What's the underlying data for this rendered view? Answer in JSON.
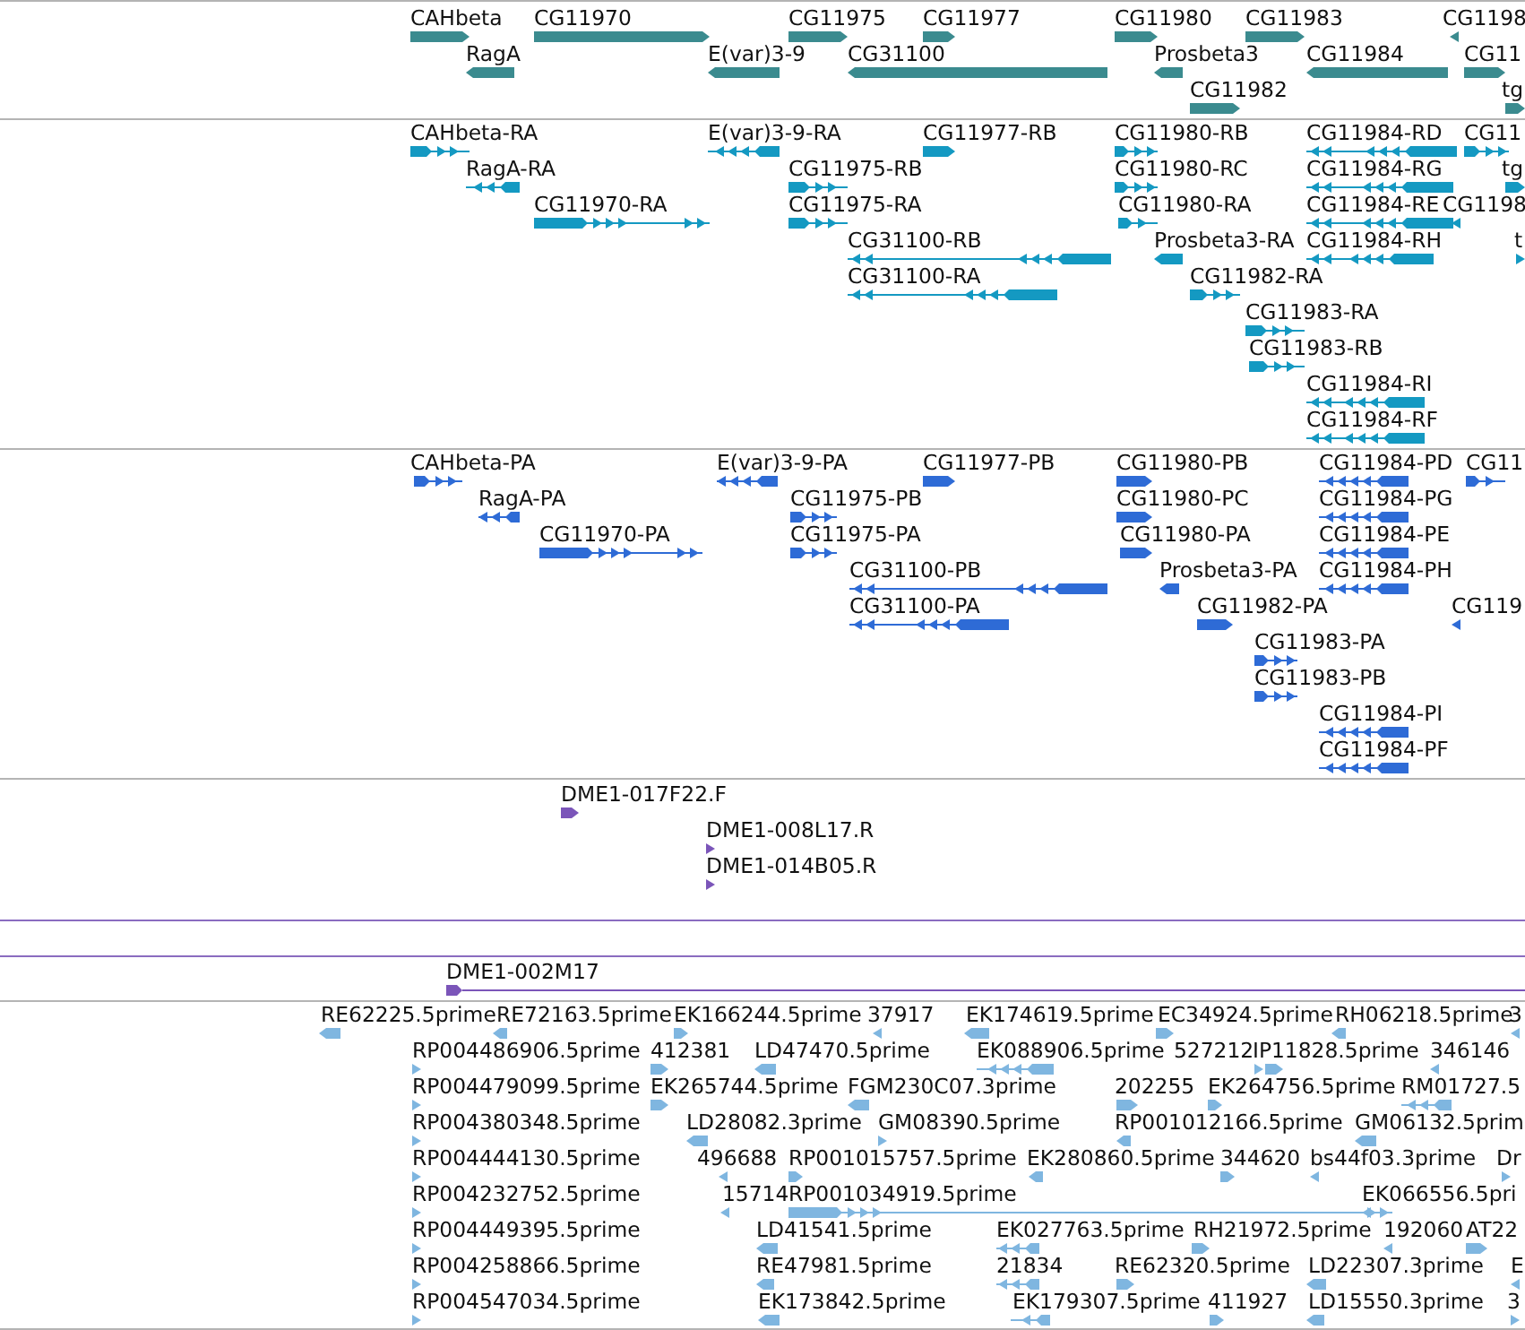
{
  "tracks": [
    {
      "kind": "gene",
      "features": [
        {
          "label": "CAHbeta",
          "forward": true
        },
        {
          "label": "CG11970",
          "forward": true
        },
        {
          "label": "CG11975",
          "forward": true
        },
        {
          "label": "CG11977",
          "forward": true
        },
        {
          "label": "CG11980",
          "forward": true
        },
        {
          "label": "CG11983",
          "forward": true
        },
        {
          "label": "CG1198",
          "forward": false
        },
        {
          "label": "RagA",
          "forward": false
        },
        {
          "label": "E(var)3-9",
          "forward": false
        },
        {
          "label": "CG31100",
          "forward": false
        },
        {
          "label": "Prosbeta3",
          "forward": false
        },
        {
          "label": "CG11984",
          "forward": false
        },
        {
          "label": "CG11",
          "forward": true
        },
        {
          "label": "CG11982",
          "forward": true
        },
        {
          "label": "tg",
          "forward": true
        }
      ]
    },
    {
      "kind": "transcript",
      "features": [
        {
          "label": "CAHbeta-RA",
          "forward": true
        },
        {
          "label": "E(var)3-9-RA",
          "forward": false
        },
        {
          "label": "CG11977-RB",
          "forward": true
        },
        {
          "label": "CG11980-RB",
          "forward": true
        },
        {
          "label": "CG11984-RD",
          "forward": false
        },
        {
          "label": "CG11",
          "forward": true
        },
        {
          "label": "RagA-RA",
          "forward": false
        },
        {
          "label": "CG11975-RB",
          "forward": true
        },
        {
          "label": "CG11980-RC",
          "forward": true
        },
        {
          "label": "CG11984-RG",
          "forward": false
        },
        {
          "label": "tg",
          "forward": true
        },
        {
          "label": "CG11970-RA",
          "forward": true
        },
        {
          "label": "CG11975-RA",
          "forward": true
        },
        {
          "label": "CG11980-RA",
          "forward": true
        },
        {
          "label": "CG11984-RE",
          "forward": false
        },
        {
          "label": "CG1198",
          "forward": false
        },
        {
          "label": "CG31100-RB",
          "forward": false
        },
        {
          "label": "Prosbeta3-RA",
          "forward": false
        },
        {
          "label": "CG11984-RH",
          "forward": false
        },
        {
          "label": "t",
          "forward": true
        },
        {
          "label": "CG31100-RA",
          "forward": false
        },
        {
          "label": "CG11982-RA",
          "forward": true
        },
        {
          "label": "CG11983-RA",
          "forward": true
        },
        {
          "label": "CG11983-RB",
          "forward": true
        },
        {
          "label": "CG11984-RI",
          "forward": false
        },
        {
          "label": "CG11984-RF",
          "forward": false
        }
      ]
    },
    {
      "kind": "protein",
      "features": [
        {
          "label": "CAHbeta-PA",
          "forward": true
        },
        {
          "label": "E(var)3-9-PA",
          "forward": false
        },
        {
          "label": "CG11977-PB",
          "forward": true
        },
        {
          "label": "CG11980-PB",
          "forward": true
        },
        {
          "label": "CG11984-PD",
          "forward": false
        },
        {
          "label": "CG11",
          "forward": true
        },
        {
          "label": "RagA-PA",
          "forward": false
        },
        {
          "label": "CG11975-PB",
          "forward": true
        },
        {
          "label": "CG11980-PC",
          "forward": true
        },
        {
          "label": "CG11984-PG",
          "forward": false
        },
        {
          "label": "CG11970-PA",
          "forward": true
        },
        {
          "label": "CG11975-PA",
          "forward": true
        },
        {
          "label": "CG11980-PA",
          "forward": true
        },
        {
          "label": "CG11984-PE",
          "forward": false
        },
        {
          "label": "CG31100-PB",
          "forward": false
        },
        {
          "label": "Prosbeta3-PA",
          "forward": false
        },
        {
          "label": "CG11984-PH",
          "forward": false
        },
        {
          "label": "CG31100-PA",
          "forward": false
        },
        {
          "label": "CG11982-PA",
          "forward": true
        },
        {
          "label": "CG119",
          "forward": false
        },
        {
          "label": "CG11983-PA",
          "forward": true
        },
        {
          "label": "CG11983-PB",
          "forward": true
        },
        {
          "label": "CG11984-PI",
          "forward": false
        },
        {
          "label": "CG11984-PF",
          "forward": false
        }
      ]
    },
    {
      "kind": "clone-end",
      "features": [
        {
          "label": "DME1-017F22.F",
          "forward": true
        },
        {
          "label": "DME1-008L17.R",
          "forward": true
        },
        {
          "label": "DME1-014B05.R",
          "forward": true
        }
      ]
    },
    {
      "kind": "clone",
      "features": [
        {
          "label": "DME1-002M17",
          "forward": true
        }
      ]
    },
    {
      "kind": "est",
      "features": [
        {
          "label": "RE62225.5prime",
          "forward": false
        },
        {
          "label": "RE72163.5prime",
          "forward": false
        },
        {
          "label": "EK166244.5prime",
          "forward": true
        },
        {
          "label": "37917",
          "forward": false
        },
        {
          "label": "EK174619.5prime",
          "forward": false
        },
        {
          "label": "EC34924.5prime",
          "forward": true
        },
        {
          "label": "RH06218.5prime",
          "forward": false
        },
        {
          "label": "3",
          "forward": false
        },
        {
          "label": "RP004486906.5prime",
          "forward": true
        },
        {
          "label": "412381",
          "forward": true
        },
        {
          "label": "LD47470.5prime",
          "forward": false
        },
        {
          "label": "EK088906.5prime",
          "forward": false
        },
        {
          "label": "527212",
          "forward": true
        },
        {
          "label": "IP11828.5prime",
          "forward": true
        },
        {
          "label": "346146",
          "forward": false
        },
        {
          "label": "RP004479099.5prime",
          "forward": true
        },
        {
          "label": "EK265744.5prime",
          "forward": true
        },
        {
          "label": "FGM230C07.3prime",
          "forward": false
        },
        {
          "label": "202255",
          "forward": true
        },
        {
          "label": "EK264756.5prime",
          "forward": true
        },
        {
          "label": "RM01727.5",
          "forward": false
        },
        {
          "label": "RP004380348.5prime",
          "forward": true
        },
        {
          "label": "LD28082.3prime",
          "forward": false
        },
        {
          "label": "GM08390.5prime",
          "forward": true
        },
        {
          "label": "RP001012166.5prime",
          "forward": false
        },
        {
          "label": "GM06132.5prim",
          "forward": false
        },
        {
          "label": "RP004444130.5prime",
          "forward": true
        },
        {
          "label": "496688",
          "forward": false
        },
        {
          "label": "RP001015757.5prime",
          "forward": true
        },
        {
          "label": "EK280860.5prime",
          "forward": false
        },
        {
          "label": "344620",
          "forward": true
        },
        {
          "label": "bs44f03.3prime",
          "forward": false
        },
        {
          "label": "Dr",
          "forward": true
        },
        {
          "label": "RP004232752.5prime",
          "forward": true
        },
        {
          "label": "15714",
          "forward": false
        },
        {
          "label": "RP001034919.5prime",
          "forward": true
        },
        {
          "label": "EK066556.5pri",
          "forward": false
        },
        {
          "label": "RP004449395.5prime",
          "forward": true
        },
        {
          "label": "LD41541.5prime",
          "forward": false
        },
        {
          "label": "EK027763.5prime",
          "forward": false
        },
        {
          "label": "RH21972.5prime",
          "forward": true
        },
        {
          "label": "192060",
          "forward": false
        },
        {
          "label": "AT22",
          "forward": true
        },
        {
          "label": "RP004258866.5prime",
          "forward": true
        },
        {
          "label": "RE47981.5prime",
          "forward": false
        },
        {
          "label": "21834",
          "forward": false
        },
        {
          "label": "RE62320.5prime",
          "forward": true
        },
        {
          "label": "LD22307.3prime",
          "forward": false
        },
        {
          "label": "E",
          "forward": false
        },
        {
          "label": "RP004547034.5prime",
          "forward": true
        },
        {
          "label": "EK173842.5prime",
          "forward": false
        },
        {
          "label": "EK179307.5prime",
          "forward": false
        },
        {
          "label": "411927",
          "forward": true
        },
        {
          "label": "LD15550.3prime",
          "forward": false
        },
        {
          "label": "3",
          "forward": true
        }
      ]
    }
  ]
}
